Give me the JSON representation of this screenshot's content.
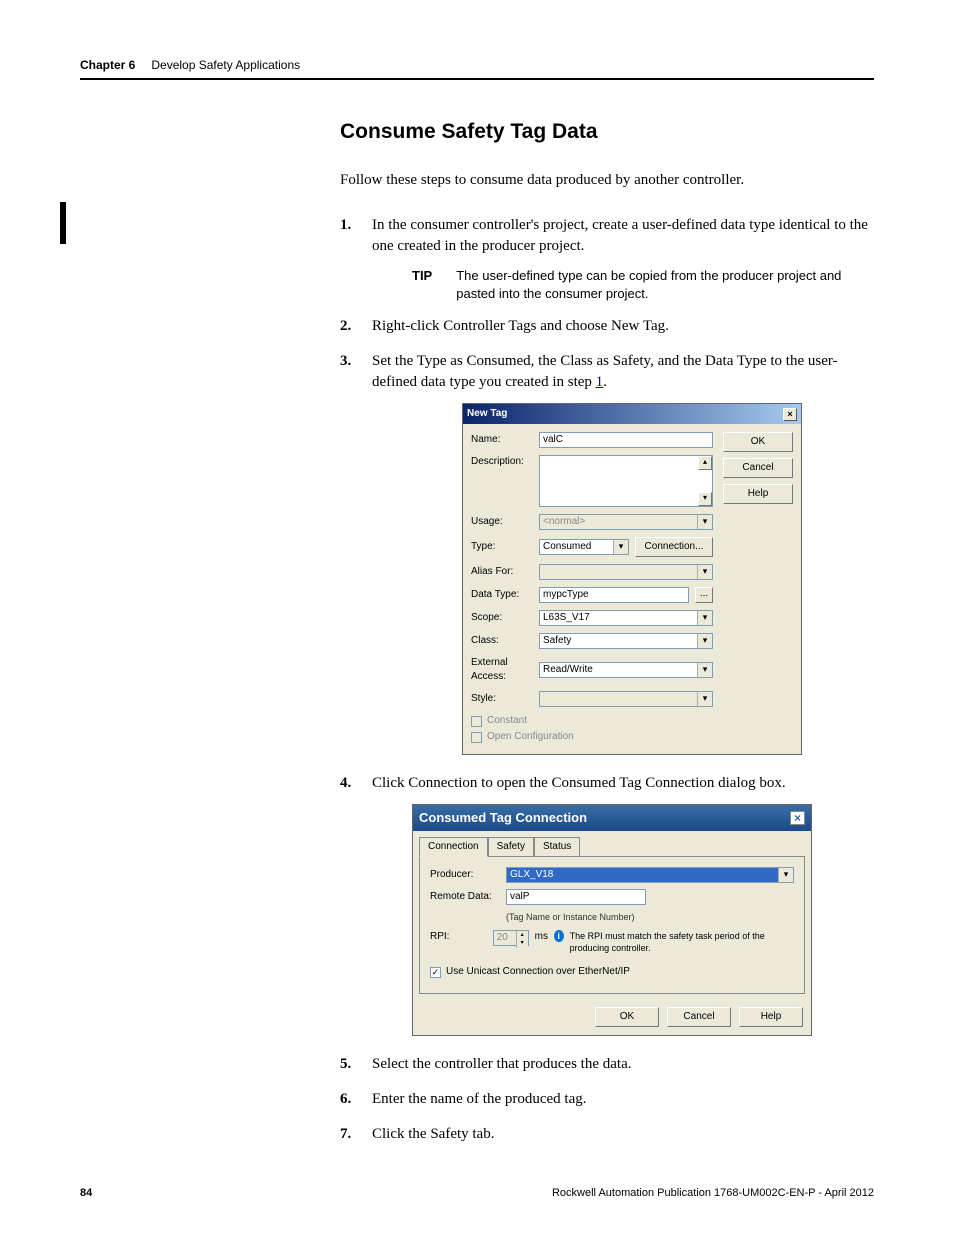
{
  "header": {
    "chapter": "Chapter 6",
    "section": "Develop Safety Applications"
  },
  "title": "Consume Safety Tag Data",
  "intro": "Follow these steps to consume data produced by another controller.",
  "steps": {
    "s1": "In the consumer controller's project, create a user-defined data type identical to the one created in the producer project.",
    "s2": "Right-click Controller Tags and choose New Tag.",
    "s3_pre": "Set the Type as Consumed, the Class as Safety, and the Data Type to the user-defined data type you created in step ",
    "s3_link": "1",
    "s3_post": ".",
    "s4": "Click Connection to open the Consumed Tag Connection dialog box.",
    "s5": "Select the controller that produces the data.",
    "s6": "Enter the name of the produced tag.",
    "s7": "Click the Safety tab."
  },
  "tip": {
    "label": "TIP",
    "text": "The user-defined type can be copied from the producer project and pasted into the consumer project."
  },
  "newtag": {
    "title": "New Tag",
    "labels": {
      "name": "Name:",
      "description": "Description:",
      "usage": "Usage:",
      "type": "Type:",
      "alias": "Alias For:",
      "datatype": "Data Type:",
      "scope": "Scope:",
      "class": "Class:",
      "external": "External Access:",
      "style": "Style:",
      "constant": "Constant",
      "opencfg": "Open Configuration"
    },
    "values": {
      "name": "valC",
      "usage": "<normal>",
      "type": "Consumed",
      "connbtn": "Connection...",
      "datatype": "mypcType",
      "scope": "L63S_V17",
      "class": "Safety",
      "external": "Read/Write"
    },
    "buttons": {
      "ok": "OK",
      "cancel": "Cancel",
      "help": "Help"
    }
  },
  "conn": {
    "title": "Consumed Tag Connection",
    "tabs": {
      "connection": "Connection",
      "safety": "Safety",
      "status": "Status"
    },
    "labels": {
      "producer": "Producer:",
      "remotedata": "Remote Data:",
      "hint": "(Tag Name or Instance Number)",
      "rpi": "RPI:",
      "ms": "ms",
      "infotext": "The RPI must match the safety task period of the producing controller.",
      "unicast": "Use Unicast Connection over EtherNet/IP"
    },
    "values": {
      "producer": "GLX_V18",
      "remotedata": "valP",
      "rpi": "20"
    },
    "buttons": {
      "ok": "OK",
      "cancel": "Cancel",
      "help": "Help"
    }
  },
  "footer": {
    "page": "84",
    "pub": "Rockwell Automation Publication 1768-UM002C-EN-P - April 2012"
  }
}
